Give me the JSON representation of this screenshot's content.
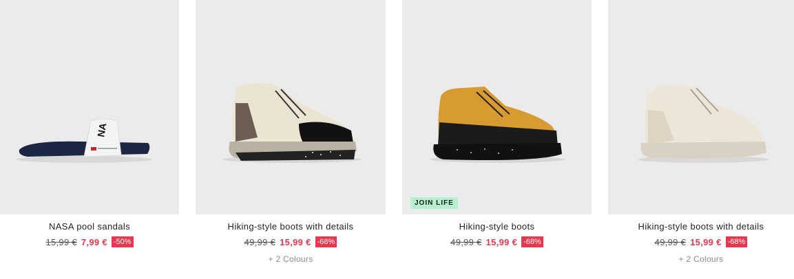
{
  "products": [
    {
      "name": "NASA pool sandals",
      "old_price": "15,99 €",
      "new_price": "7,99 €",
      "discount": "-50%",
      "colours": ""
    },
    {
      "name": "Hiking-style boots with details",
      "old_price": "49,99 €",
      "new_price": "15,99 €",
      "discount": "-68%",
      "colours": "+ 2 Colours"
    },
    {
      "name": "Hiking-style boots",
      "old_price": "49,99 €",
      "new_price": "15,99 €",
      "discount": "-68%",
      "colours": "",
      "badge": "JOIN LIFE"
    },
    {
      "name": "Hiking-style boots with details",
      "old_price": "49,99 €",
      "new_price": "15,99 €",
      "discount": "-68%",
      "colours": "+ 2 Colours"
    }
  ],
  "colors": {
    "image_bg": "#ebebeb",
    "sale_red": "#e8384f",
    "badge_green": "#b7f0cf"
  }
}
